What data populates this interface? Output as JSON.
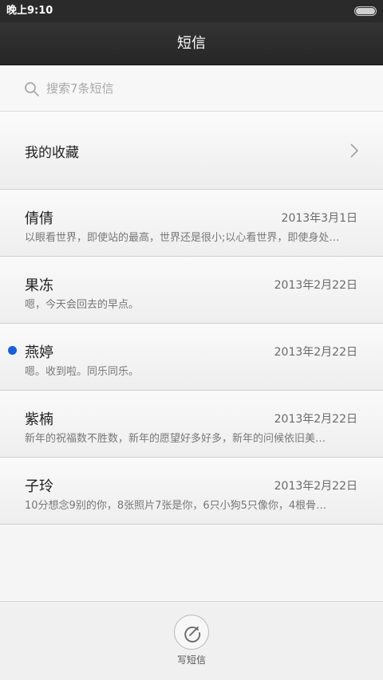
{
  "status_bar": {
    "time": "晚上9:10"
  },
  "header": {
    "title": "短信"
  },
  "search": {
    "placeholder": "搜索7条短信"
  },
  "favorites": {
    "label": "我的收藏"
  },
  "conversations": [
    {
      "name": "倩倩",
      "date": "2013年3月1日",
      "preview": "以眼看世界，即使站的最高，世界还是很小;以心看世界，即使身处…",
      "unread": false
    },
    {
      "name": "果冻",
      "date": "2013年2月22日",
      "preview": "嗯，今天会回去的早点。",
      "unread": false
    },
    {
      "name": "燕婷",
      "date": "2013年2月22日",
      "preview": "嗯。收到啦。同乐同乐。",
      "unread": true
    },
    {
      "name": "紫楠",
      "date": "2013年2月22日",
      "preview": "新年的祝福数不胜数，新年的愿望好多好多，新年的问候依旧美…",
      "unread": false
    },
    {
      "name": "子玲",
      "date": "2013年2月22日",
      "preview": "10分想念9别的你，8张照片7张是你，6只小狗5只像你，4根骨…",
      "unread": false
    }
  ],
  "bottom_bar": {
    "compose_label": "写短信"
  },
  "colors": {
    "unread_dot": "#1a5fd8"
  },
  "icons": {
    "search": "search-icon",
    "chevron": "chevron-right-icon",
    "compose": "compose-icon",
    "battery": "battery-icon"
  }
}
